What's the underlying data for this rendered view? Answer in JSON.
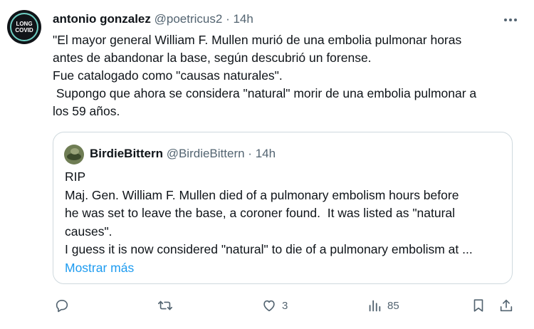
{
  "tweet": {
    "author": {
      "name": "antonio gonzalez",
      "handle": "@poetricus2",
      "time": "14h",
      "avatar_text_1": "LONG",
      "avatar_text_2": "COVID"
    },
    "separator": "·",
    "text_lines": [
      "\"El mayor general William F. Mullen murió de una embolia pulmonar horas",
      "antes de abandonar la base, según descubrió un forense.",
      "Fue catalogado como \"causas naturales\".",
      " Supongo que ahora se considera \"natural\" morir de una embolia pulmonar a",
      "los 59 años."
    ]
  },
  "quote": {
    "author": {
      "name": "BirdieBittern",
      "handle": "@BirdieBittern",
      "time": "14h"
    },
    "text_lines": [
      "RIP",
      "Maj. Gen. William F. Mullen died of a pulmonary embolism hours before",
      "he was set to leave the base, a coroner found.  It was listed as \"natural",
      "causes\".",
      "I guess it is now considered \"natural\" to die of a pulmonary embolism at ..."
    ],
    "show_more": "Mostrar más"
  },
  "actions": {
    "reply": {
      "icon": "reply-icon",
      "count": ""
    },
    "retweet": {
      "icon": "retweet-icon",
      "count": ""
    },
    "like": {
      "icon": "heart-icon",
      "count": "3"
    },
    "views": {
      "icon": "views-icon",
      "count": "85"
    },
    "bookmark": {
      "icon": "bookmark-icon"
    },
    "share": {
      "icon": "share-icon"
    }
  },
  "colors": {
    "text": "#0f1419",
    "secondary": "#536471",
    "link": "#1d9bf0",
    "border": "#cfd9de"
  }
}
